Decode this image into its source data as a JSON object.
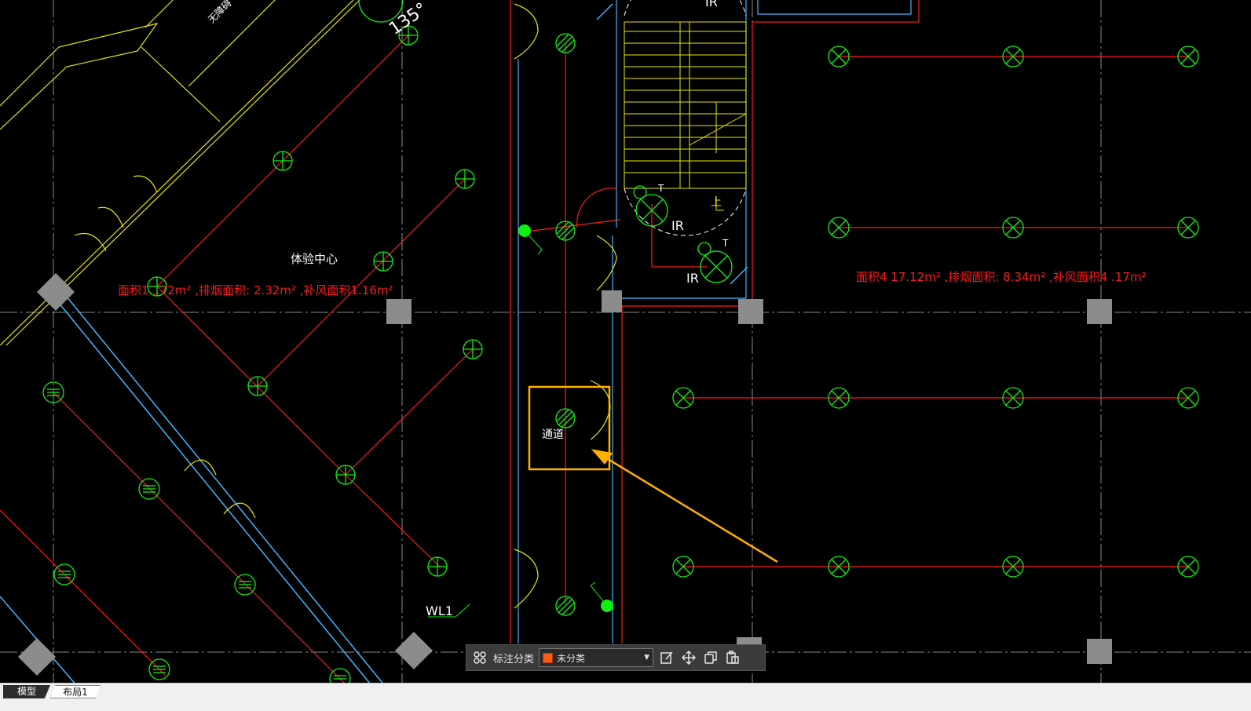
{
  "drawing": {
    "room_label": "体验中心",
    "corridor_label": "通道",
    "left_area_note": "面积1 ,.72m² ,排烟面积: 2.32m² ,补风面积1.16m²",
    "right_area_note": "面积4 17.12m² ,排烟面积: 8.34m² ,补风面积4 .17m²",
    "angle_label": "135°",
    "wl_label": "WL1",
    "ir_labels": [
      "IR",
      "IR",
      "IR"
    ],
    "t_labels": [
      "T",
      "T"
    ],
    "up_label": "上",
    "rotated_label": "无障碍",
    "colors": {
      "background": "#000000",
      "red_line": "#ff1a1a",
      "green_symbol": "#11ee11",
      "yellow": "#e8e800",
      "cyan_wall": "#3fb6ff",
      "grid": "#8a8a8a",
      "highlight": "#ffb000",
      "column": "#8c8c8c"
    }
  },
  "annotation_toolbar": {
    "grid_icon": "grid-icon",
    "label": "标注分类",
    "category_value": "未分类",
    "category_color": "#ff5a14",
    "icons": [
      "edit-icon",
      "move-icon",
      "copy-icon",
      "paste-icon"
    ]
  },
  "status_bar": {
    "tabs": [
      "模型",
      "布局1"
    ]
  }
}
